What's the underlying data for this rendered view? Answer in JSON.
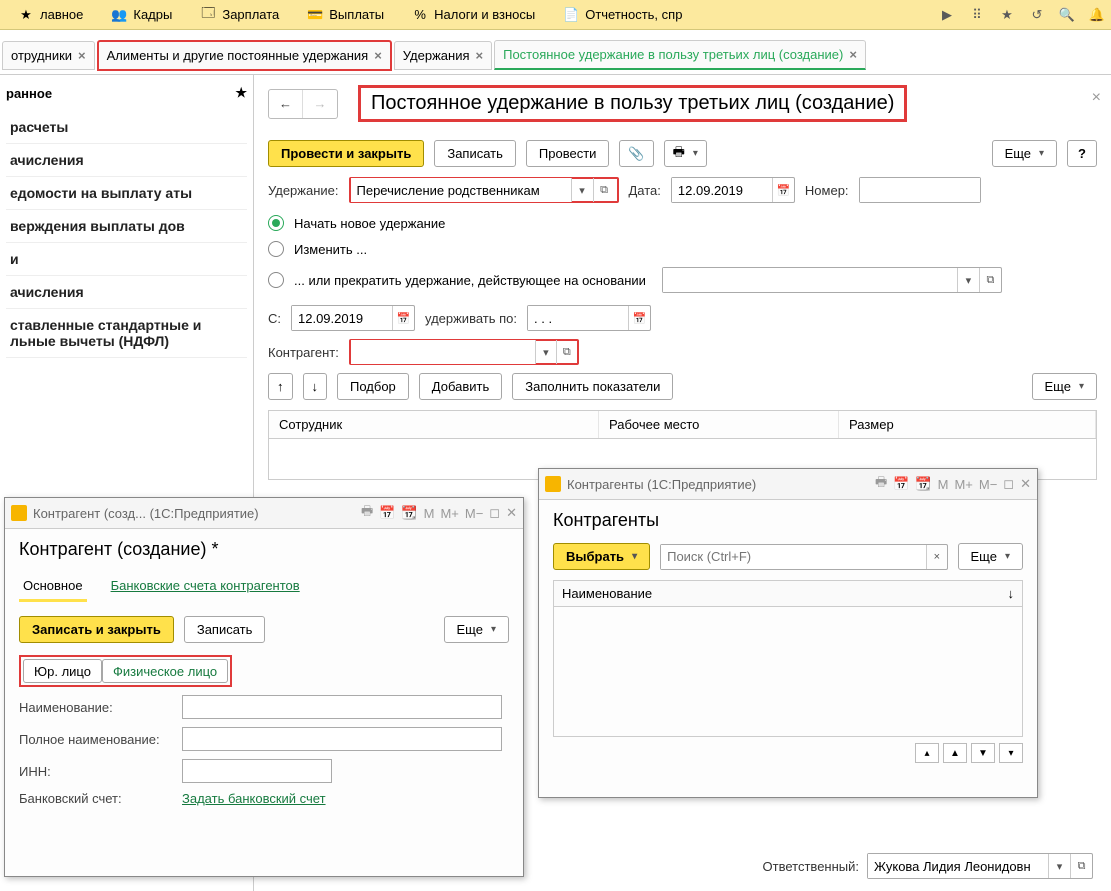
{
  "topbar": {
    "items": [
      {
        "label": "лавное",
        "icon": "star"
      },
      {
        "label": "Кадры",
        "icon": "people"
      },
      {
        "label": "Зарплата",
        "icon": "calc"
      },
      {
        "label": "Выплаты",
        "icon": "wallet"
      },
      {
        "label": "Налоги и взносы",
        "icon": "percent"
      },
      {
        "label": "Отчетность, спр",
        "icon": "report"
      }
    ]
  },
  "tabs": [
    {
      "label": "отрудники",
      "closable": true
    },
    {
      "label": "Алименты и другие постоянные удержания",
      "closable": true,
      "highlighted": true
    },
    {
      "label": "Удержания",
      "closable": true
    },
    {
      "label": "Постоянное удержание в пользу третьих лиц (создание)",
      "closable": true,
      "active": true
    }
  ],
  "sidebar": {
    "title": "ранное",
    "items": [
      "расчеты",
      "ачисления",
      "едомости на выплату аты",
      "верждения выплаты дов",
      "и",
      "ачисления",
      "ставленные стандартные и льные вычеты (НДФЛ)"
    ]
  },
  "main": {
    "title": "Постоянное удержание в пользу третьих лиц (создание)",
    "toolbar": {
      "primary": "Провести и закрыть",
      "save": "Записать",
      "post": "Провести",
      "more": "Еще"
    },
    "fields": {
      "deduction_label": "Удержание:",
      "deduction_value": "Перечисление родственникам",
      "date_label": "Дата:",
      "date_value": "12.09.2019",
      "number_label": "Номер:",
      "number_value": ""
    },
    "radios": {
      "new": "Начать новое удержание",
      "edit": "Изменить ...",
      "stop": "... или прекратить удержание, действующее на основании"
    },
    "period": {
      "from_label": "С:",
      "from_value": "12.09.2019",
      "to_label": "удерживать по:",
      "to_value": ". . ."
    },
    "counterparty_label": "Контрагент:",
    "counterparty_value": "",
    "table_toolbar": {
      "pick": "Подбор",
      "add": "Добавить",
      "fill": "Заполнить показатели",
      "more": "Еще"
    },
    "columns": [
      "Сотрудник",
      "Рабочее место",
      "Размер"
    ]
  },
  "dialog1": {
    "titlebar": "Контрагент (созд...  (1С:Предприятие)",
    "heading": "Контрагент (создание) *",
    "tabs": {
      "main": "Основное",
      "bank": "Банковские счета контрагентов"
    },
    "toolbar": {
      "primary": "Записать и закрыть",
      "save": "Записать",
      "more": "Еще"
    },
    "seg": {
      "legal": "Юр. лицо",
      "individual": "Физическое лицо"
    },
    "fields": {
      "name_label": "Наименование:",
      "fullname_label": "Полное наименование:",
      "inn_label": "ИНН:",
      "bank_label": "Банковский счет:",
      "bank_link": "Задать банковский счет"
    }
  },
  "dialog2": {
    "titlebar": "Контрагенты (1С:Предприятие)",
    "heading": "Контрагенты",
    "toolbar": {
      "select": "Выбрать",
      "more": "Еще",
      "search_placeholder": "Поиск (Ctrl+F)"
    },
    "column": "Наименование"
  },
  "footer": {
    "responsible_label": "Ответственный:",
    "responsible_value": "Жукова Лидия Леонидовн"
  }
}
